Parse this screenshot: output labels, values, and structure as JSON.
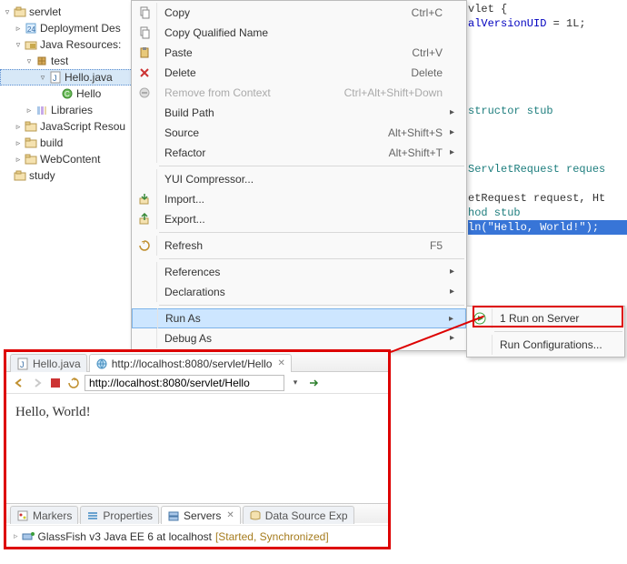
{
  "tree": {
    "items": [
      {
        "label": "servlet",
        "twisty": "▿",
        "icon": "project-icon",
        "indent": 0
      },
      {
        "label": "Deployment Des",
        "twisty": "▹",
        "icon": "dd-icon",
        "indent": 1
      },
      {
        "label": "Java Resources:",
        "twisty": "▿",
        "icon": "folder-jar-icon",
        "indent": 1
      },
      {
        "label": "test",
        "twisty": "▿",
        "icon": "package-icon",
        "indent": 2
      },
      {
        "label": "Hello.java",
        "twisty": "▿",
        "icon": "java-file-icon",
        "indent": 3,
        "selected": true
      },
      {
        "label": "Hello",
        "twisty": " ",
        "icon": "class-icon",
        "indent": 4
      },
      {
        "label": "Libraries",
        "twisty": "▹",
        "icon": "library-icon",
        "indent": 2
      },
      {
        "label": "JavaScript Resou",
        "twisty": "▹",
        "icon": "folder-icon",
        "indent": 1
      },
      {
        "label": "build",
        "twisty": "▹",
        "icon": "folder-icon",
        "indent": 1
      },
      {
        "label": "WebContent",
        "twisty": "▹",
        "icon": "folder-icon",
        "indent": 1
      },
      {
        "label": "study",
        "twisty": " ",
        "icon": "project-icon",
        "indent": 0
      }
    ]
  },
  "editor": {
    "lines": [
      {
        "segments": [
          {
            "t": "vlet {",
            "c": ""
          }
        ]
      },
      {
        "segments": [
          {
            "t": "alVersionUID",
            "c": "id"
          },
          {
            "t": " = 1L;",
            "c": ""
          }
        ]
      },
      {
        "segments": []
      },
      {
        "segments": []
      },
      {
        "segments": []
      },
      {
        "segments": []
      },
      {
        "segments": []
      },
      {
        "segments": [
          {
            "t": "structor stub",
            "c": "cm"
          }
        ]
      },
      {
        "segments": []
      },
      {
        "segments": []
      },
      {
        "segments": []
      },
      {
        "segments": [
          {
            "t": "ServletRequest reques",
            "c": "cm"
          }
        ]
      },
      {
        "segments": []
      },
      {
        "segments": [
          {
            "t": "etRequest request, Ht",
            "c": ""
          }
        ]
      },
      {
        "segments": [
          {
            "t": "hod stub",
            "c": "cm"
          }
        ]
      },
      {
        "segments": [
          {
            "t": "ln(",
            "c": ""
          },
          {
            "t": "\"Hello, World!\"",
            "c": "str"
          },
          {
            "t": ");",
            "c": ""
          }
        ],
        "hl": true
      },
      {
        "segments": []
      }
    ]
  },
  "menu": {
    "items": [
      {
        "label": "Copy",
        "shortcut": "Ctrl+C",
        "icon": "copy-icon"
      },
      {
        "label": "Copy Qualified Name",
        "shortcut": "",
        "icon": "copy-icon"
      },
      {
        "label": "Paste",
        "shortcut": "Ctrl+V",
        "icon": "paste-icon"
      },
      {
        "label": "Delete",
        "shortcut": "Delete",
        "icon": "delete-icon"
      },
      {
        "label": "Remove from Context",
        "shortcut": "Ctrl+Alt+Shift+Down",
        "icon": "remove-icon",
        "disabled": true
      },
      {
        "label": "Build Path",
        "shortcut": "",
        "arrow": true
      },
      {
        "label": "Source",
        "shortcut": "Alt+Shift+S",
        "arrow": true
      },
      {
        "label": "Refactor",
        "shortcut": "Alt+Shift+T",
        "arrow": true
      },
      {
        "sep": true
      },
      {
        "label": "YUI Compressor...",
        "shortcut": ""
      },
      {
        "label": "Import...",
        "shortcut": "",
        "icon": "import-icon"
      },
      {
        "label": "Export...",
        "shortcut": "",
        "icon": "export-icon"
      },
      {
        "sep": true
      },
      {
        "label": "Refresh",
        "shortcut": "F5",
        "icon": "refresh-icon"
      },
      {
        "sep": true
      },
      {
        "label": "References",
        "shortcut": "",
        "arrow": true
      },
      {
        "label": "Declarations",
        "shortcut": "",
        "arrow": true
      },
      {
        "sep": true
      },
      {
        "label": "Run As",
        "shortcut": "",
        "arrow": true,
        "hover": true
      },
      {
        "label": "Debug As",
        "shortcut": "",
        "arrow": true
      }
    ]
  },
  "submenu": {
    "items": [
      {
        "label": "1 Run on Server",
        "icon": "run-server-icon"
      },
      {
        "sep": true
      },
      {
        "label": "Run Configurations..."
      }
    ]
  },
  "preview": {
    "tabs": [
      {
        "label": "Hello.java",
        "icon": "java-file-icon"
      },
      {
        "label": "http://localhost:8080/servlet/Hello",
        "icon": "globe-icon",
        "closeable": true,
        "active": true
      }
    ],
    "url": "http://localhost:8080/servlet/Hello",
    "body": "Hello, World!",
    "bottomTabs": [
      {
        "label": "Markers",
        "icon": "markers-icon"
      },
      {
        "label": "Properties",
        "icon": "properties-icon"
      },
      {
        "label": "Servers",
        "icon": "servers-icon",
        "active": true,
        "closeable": true
      },
      {
        "label": "Data Source Exp",
        "icon": "datasource-icon"
      }
    ],
    "server": {
      "name": "GlassFish v3 Java EE 6 at localhost",
      "status": "[Started, Synchronized]"
    }
  }
}
